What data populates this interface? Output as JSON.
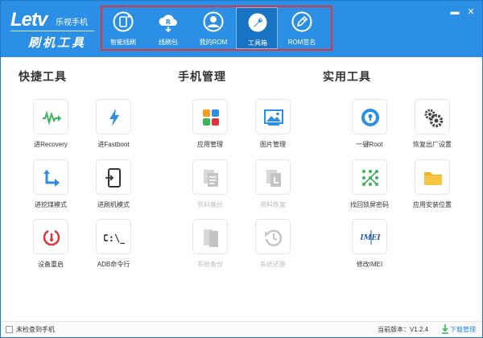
{
  "app": {
    "brand": "Letv",
    "brand_sub": "乐视手机",
    "title": "刷机工具"
  },
  "nav": [
    {
      "label": "智能线刷",
      "icon": "phone-refresh-icon"
    },
    {
      "label": "线刷包",
      "icon": "cloud-download-icon"
    },
    {
      "label": "我的ROM",
      "icon": "user-icon"
    },
    {
      "label": "工具箱",
      "icon": "wrench-icon"
    },
    {
      "label": "ROM签名",
      "icon": "pen-sign-icon"
    }
  ],
  "window_buttons": {
    "minimize": "▬",
    "close": "✕"
  },
  "sections": [
    {
      "title": "快捷工具",
      "tools": [
        {
          "label": "进Recovery",
          "icon": "recovery-icon",
          "disabled": false
        },
        {
          "label": "进Fastboot",
          "icon": "lightning-icon",
          "disabled": false
        },
        {
          "label": "进挖煤模式",
          "icon": "arrow-bend-icon",
          "disabled": false
        },
        {
          "label": "进刷机模式",
          "icon": "phone-flash-icon",
          "disabled": false
        },
        {
          "label": "设备重启",
          "icon": "restart-icon",
          "disabled": false
        },
        {
          "label": "ADB命令行",
          "icon": "terminal-icon",
          "disabled": false
        }
      ]
    },
    {
      "title": "手机管理",
      "tools": [
        {
          "label": "应用管理",
          "icon": "apps-grid-icon",
          "disabled": false
        },
        {
          "label": "图片管理",
          "icon": "image-icon",
          "disabled": false
        },
        {
          "label": "资料备份",
          "icon": "doc-backup-icon",
          "disabled": true
        },
        {
          "label": "资料恢复",
          "icon": "doc-restore-icon",
          "disabled": true
        },
        {
          "label": "系统备份",
          "icon": "system-backup-icon",
          "disabled": true
        },
        {
          "label": "系统还原",
          "icon": "system-restore-icon",
          "disabled": true
        }
      ]
    },
    {
      "title": "实用工具",
      "tools": [
        {
          "label": "一键Root",
          "icon": "lock-root-icon",
          "disabled": false
        },
        {
          "label": "恢复出厂设置",
          "icon": "gears-icon",
          "disabled": false
        },
        {
          "label": "找回锁屏密码",
          "icon": "pattern-lock-icon",
          "disabled": false
        },
        {
          "label": "应用安装位置",
          "icon": "folder-icon",
          "disabled": false
        },
        {
          "label": "修改IMEI",
          "icon": "imei-icon",
          "disabled": false
        }
      ]
    }
  ],
  "statusbar": {
    "status": "未检查到手机",
    "version": "当前版本：V1.2.4",
    "download": "下载管理"
  },
  "colors": {
    "header": "#2b8fe6",
    "accent_red": "#e0353b",
    "disabled": "#bdbdbd"
  }
}
